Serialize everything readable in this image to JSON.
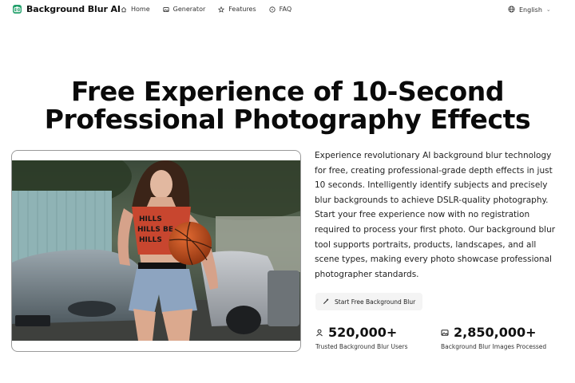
{
  "nav": {
    "brand": "Background Blur AI",
    "links": [
      {
        "label": "Home",
        "icon": "home-icon"
      },
      {
        "label": "Generator",
        "icon": "image-icon"
      },
      {
        "label": "Features",
        "icon": "star-icon"
      },
      {
        "label": "FAQ",
        "icon": "help-icon"
      }
    ],
    "language": "English"
  },
  "hero": {
    "title_line1": "Free Experience of 10-Second",
    "title_line2": "Professional Photography Effects"
  },
  "main": {
    "description": "Experience revolutionary AI background blur technology for free, creating professional-grade depth effects in just 10 seconds. Intelligently identify subjects and precisely blur backgrounds to achieve DSLR-quality photography. Start your free experience now with no registration required to process your first photo. Our background blur tool supports portraits, products, landscapes, and all scene types, making every photo showcase professional photographer standards.",
    "cta_label": "Start Free Background Blur",
    "stats": [
      {
        "value": "520,000+",
        "label": "Trusted Background Blur Users",
        "icon": "user-icon"
      },
      {
        "value": "2,850,000+",
        "label": "Background Blur Images Processed",
        "icon": "image-icon"
      }
    ]
  },
  "colors": {
    "brand_green": "#22a06b",
    "cta_bg": "#f4f4f4",
    "card_border": "#9a9a9a"
  }
}
